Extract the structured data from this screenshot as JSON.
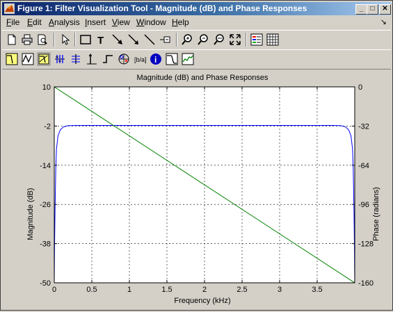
{
  "window": {
    "title": "Figure 1: Filter Visualization Tool - Magnitude (dB) and Phase Responses",
    "min_glyph": "_",
    "max_glyph": "□",
    "close_glyph": "✕"
  },
  "menu": {
    "items": [
      {
        "label": "File",
        "u": "F",
        "rest": "ile"
      },
      {
        "label": "Edit",
        "u": "E",
        "rest": "dit"
      },
      {
        "label": "Analysis",
        "u": "A",
        "rest": "nalysis"
      },
      {
        "label": "Insert",
        "u": "I",
        "rest": "nsert"
      },
      {
        "label": "View",
        "u": "V",
        "rest": "iew"
      },
      {
        "label": "Window",
        "u": "W",
        "rest": "indow"
      },
      {
        "label": "Help",
        "u": "H",
        "rest": "elp"
      }
    ],
    "dock_arrow": "↘"
  },
  "toolbar1": {
    "buttons": [
      "new-figure-icon",
      "print-icon",
      "print-preview-icon",
      "select-arrow-icon",
      "insert-rectangle-icon",
      "insert-text-icon",
      "insert-arrow-icon",
      "insert-line-icon",
      "insert-legend-icon",
      "zoom-in-icon",
      "zoom-out-icon",
      "zoom-x-icon",
      "zoom-y-icon",
      "legend-toggle-icon",
      "grid-toggle-icon"
    ]
  },
  "toolbar2": {
    "buttons": [
      "magnitude-response-icon",
      "phase-response-icon",
      "mag-phase-response-icon",
      "group-delay-icon",
      "phase-delay-icon",
      "impulse-response-icon",
      "step-response-icon",
      "pole-zero-icon",
      "coefficients-icon",
      "filter-info-icon",
      "magnitude-estimate-icon",
      "round-off-noise-icon"
    ]
  },
  "chart_data": {
    "type": "line",
    "title": "Magnitude (dB) and Phase Responses",
    "xlabel": "Frequency (kHz)",
    "ylabel": "Magnitude (dB)",
    "y2label": "Phase (radians)",
    "xlim": [
      0,
      4
    ],
    "ylim": [
      -50,
      10
    ],
    "y2lim": [
      -160,
      0
    ],
    "xticks": [
      "0",
      "0.5",
      "1",
      "1.5",
      "2",
      "2.5",
      "3",
      "3.5"
    ],
    "xtick_values": [
      0,
      0.5,
      1,
      1.5,
      2,
      2.5,
      3,
      3.5
    ],
    "yticks": [
      "10",
      "-2",
      "-14",
      "-26",
      "-38",
      "-50"
    ],
    "ytick_values": [
      10,
      -2,
      -14,
      -26,
      -38,
      -50
    ],
    "y2ticks": [
      "0",
      "-32",
      "-64",
      "-96",
      "-128",
      "-160"
    ],
    "y2tick_values": [
      0,
      -32,
      -64,
      -96,
      -128,
      -160
    ],
    "grid": true,
    "series": [
      {
        "axis": "left",
        "color": "#0000ff",
        "x": [
          0,
          0.005,
          0.01,
          0.02,
          0.03,
          0.05,
          0.08,
          0.12,
          0.18,
          0.3,
          1.0,
          2.0,
          3.0,
          3.7,
          3.82,
          3.88,
          3.92,
          3.95,
          3.97,
          3.98,
          3.99,
          3.995,
          4.0
        ],
        "y": [
          -50,
          -38,
          -28,
          -15,
          -9,
          -5,
          -3.2,
          -2.3,
          -1.9,
          -1.8,
          -1.8,
          -1.8,
          -1.8,
          -1.8,
          -1.9,
          -2.3,
          -3.2,
          -5,
          -9,
          -15,
          -28,
          -38,
          -50
        ]
      },
      {
        "axis": "right",
        "color": "#008000",
        "x": [
          0,
          4
        ],
        "y": [
          0,
          -160
        ]
      }
    ]
  }
}
